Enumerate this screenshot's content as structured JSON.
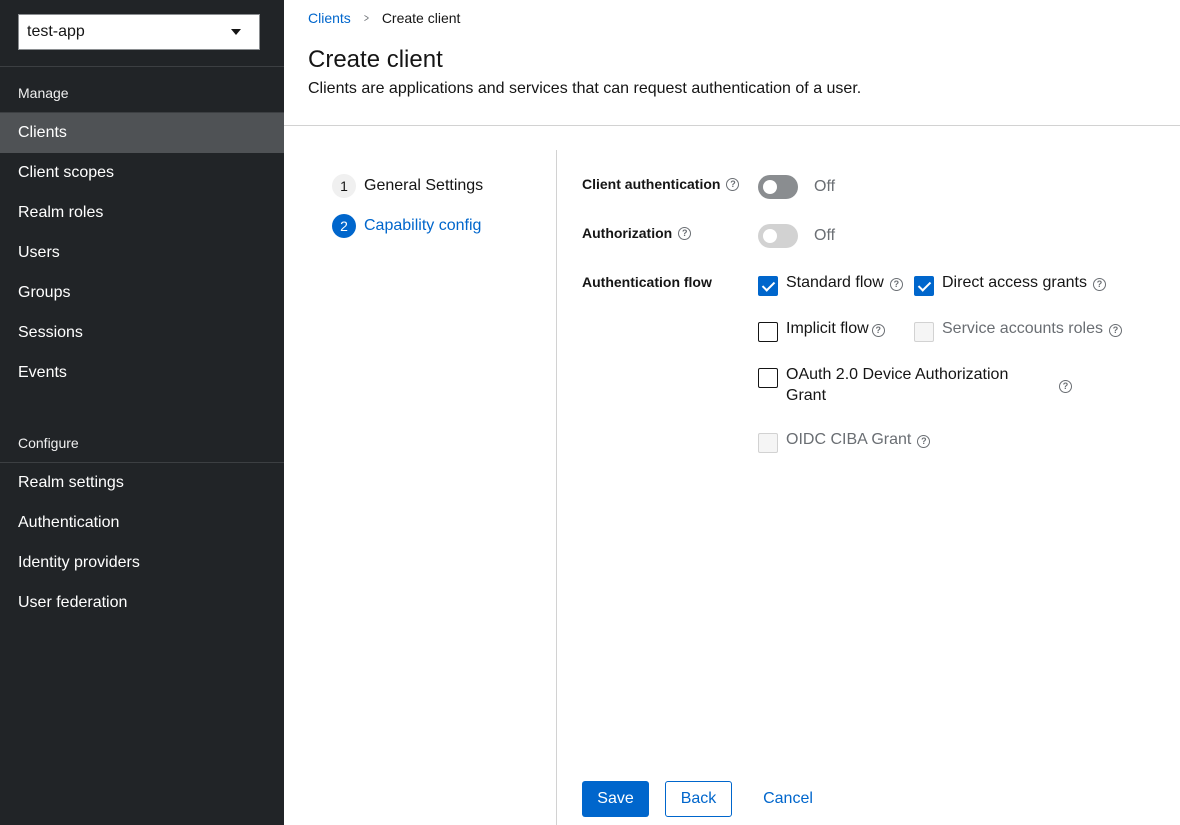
{
  "sidebar": {
    "realm": "test-app",
    "sections": [
      {
        "title": "Manage",
        "items": [
          "Clients",
          "Client scopes",
          "Realm roles",
          "Users",
          "Groups",
          "Sessions",
          "Events"
        ]
      },
      {
        "title": "Configure",
        "items": [
          "Realm settings",
          "Authentication",
          "Identity providers",
          "User federation"
        ]
      }
    ],
    "active_item": "Clients"
  },
  "breadcrumb": {
    "parent": "Clients",
    "current": "Create client"
  },
  "page": {
    "title": "Create client",
    "description": "Clients are applications and services that can request authentication of a user."
  },
  "wizard": {
    "steps": [
      {
        "num": "1",
        "label": "General Settings",
        "state": "done"
      },
      {
        "num": "2",
        "label": "Capability config",
        "state": "current"
      }
    ]
  },
  "form": {
    "client_authentication": {
      "label": "Client authentication",
      "state": "Off",
      "enabled": true
    },
    "authorization": {
      "label": "Authorization",
      "state": "Off",
      "enabled": false
    },
    "auth_flow": {
      "label": "Authentication flow",
      "options": {
        "standard_flow": {
          "label": "Standard flow",
          "checked": true,
          "disabled": false
        },
        "direct_access": {
          "label": "Direct access grants",
          "checked": true,
          "disabled": false
        },
        "implicit_flow": {
          "label": "Implicit flow",
          "checked": false,
          "disabled": false
        },
        "service_accounts": {
          "label": "Service accounts roles",
          "checked": false,
          "disabled": true
        },
        "device_grant": {
          "label_line1": "OAuth 2.0 Device Authorization",
          "label_line2": "Grant",
          "checked": false,
          "disabled": false
        },
        "ciba": {
          "label": "OIDC CIBA Grant",
          "checked": false,
          "disabled": true
        }
      }
    }
  },
  "buttons": {
    "save": "Save",
    "back": "Back",
    "cancel": "Cancel"
  },
  "colors": {
    "primary": "#0066cc",
    "sidebar_bg": "#212427",
    "active_nav": "#4f5255"
  },
  "icons": {
    "help": "help-icon",
    "caret": "caret-down-icon",
    "breadcrumb_separator": "chevron-right-icon"
  }
}
